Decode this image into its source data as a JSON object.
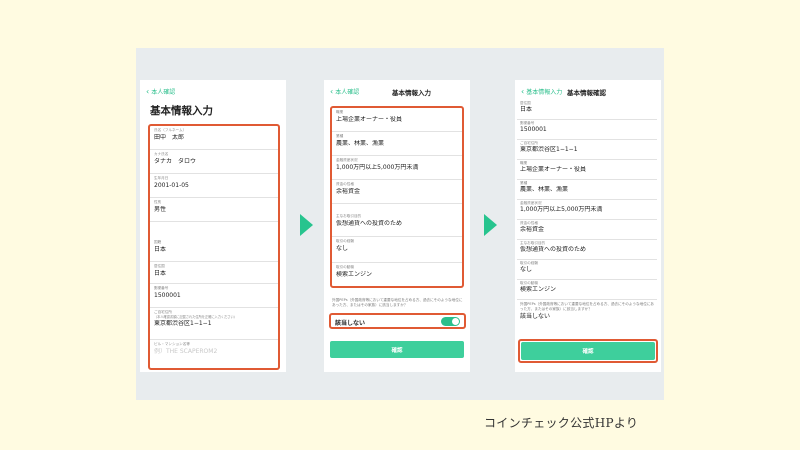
{
  "screen1": {
    "back_label": "本人確認",
    "title": "基本情報入力",
    "fields": [
      {
        "label": "氏名（フルネーム）",
        "value": "田中　太郎"
      },
      {
        "label": "カナ氏名",
        "value": "タナカ　タロウ"
      },
      {
        "label": "生年月日",
        "value": "2001-01-05"
      },
      {
        "label": "性別",
        "value": "男性"
      },
      {
        "label": "国籍",
        "value": "日本"
      },
      {
        "label": "居住国",
        "value": "日本"
      },
      {
        "label": "郵便番号",
        "value": "1500001"
      },
      {
        "label": "ご自宅住所",
        "hint": "（本人確認書類に記載された住所を正確に入力ください）",
        "value": "東京都渋谷区1−1−1"
      },
      {
        "label": "ビル・マンション名等",
        "placeholder": "例）THE SCAPEROM2"
      }
    ]
  },
  "screen2": {
    "back_label": "本人確認",
    "title": "基本情報入力",
    "fields": [
      {
        "label": "職業",
        "value": "上場企業オーナー・役員"
      },
      {
        "label": "業種",
        "value": "農業、林業、漁業"
      },
      {
        "label": "金融資産状況",
        "value": "1,000万円以上5,000万円未満"
      },
      {
        "label": "資金の性格",
        "value": "余裕資金"
      },
      {
        "label": "主なお取引目的",
        "value": "仮想通貨への投資のため"
      },
      {
        "label": "取引の経験",
        "value": "なし"
      },
      {
        "label": "取引の動機",
        "value": "検索エンジン"
      }
    ],
    "pep_note": "外国PEPs（外国政府等において重要な地位を占める方、過去にそのような地位にあった方、またはその家族）に該当しますか？",
    "pep_label": "該当しない",
    "pep_toggle_on": true,
    "confirm_label": "確認"
  },
  "screen3": {
    "back_label": "基本情報入力",
    "title": "基本情報確認",
    "fields": [
      {
        "label": "居住国",
        "value": "日本"
      },
      {
        "label": "郵便番号",
        "value": "1500001"
      },
      {
        "label": "ご自宅住所",
        "value": "東京都渋谷区1−1−1"
      },
      {
        "label": "職業",
        "value": "上場企業オーナー・役員"
      },
      {
        "label": "業種",
        "value": "農業、林業、漁業"
      },
      {
        "label": "金融資産状況",
        "value": "1,000万円以上5,000万円未満"
      },
      {
        "label": "資金の性格",
        "value": "余裕資金"
      },
      {
        "label": "主なお取引目的",
        "value": "仮想通貨への投資のため"
      },
      {
        "label": "取引の経験",
        "value": "なし"
      },
      {
        "label": "取引の動機",
        "value": "検索エンジン"
      }
    ],
    "pep_note": "外国PEPs（外国政府等において重要な地位を占める方、過去にそのような地位にあった方、またはその家族）に該当しますか？",
    "pep_value": "該当しない",
    "confirm_label": "確認"
  },
  "caption": "コインチェック公式HPより",
  "colors": {
    "accent": "#3ecf9c",
    "highlight": "#e05a34",
    "background": "#fffbe1"
  }
}
